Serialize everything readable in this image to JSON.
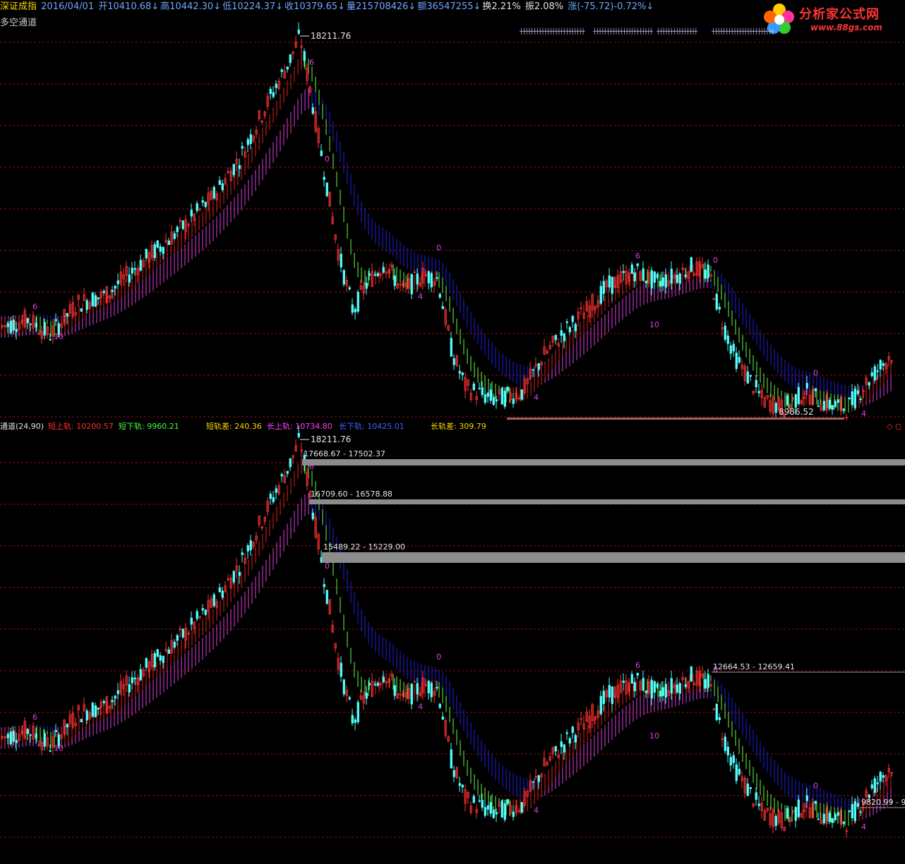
{
  "header": {
    "name": "深证成指",
    "date": "2016/04/01",
    "open": "开10410.68↓",
    "high": "高10442.30↓",
    "low": "低10224.37↓",
    "close": "收10379.65↓",
    "volume": "量215708426↓",
    "amount": "额36547255↓",
    "turnover": "换2.21%",
    "amplitude": "振2.08%",
    "change": "涨(-75.72)-0.72%↓"
  },
  "indicator_name": "多空通道",
  "logo": {
    "text": "分析家公式网",
    "url": "www.88gs.com"
  },
  "sub_header": {
    "name": "通道(24,90)",
    "short_upper": "短上轨: 10200.57",
    "short_lower": "短下轨: 9960.21",
    "short_diff": "短轨差: 240.36",
    "long_upper": "长上轨: 10734.80",
    "long_lower": "长下轨: 10425.01",
    "long_diff": "长轨差: 309.79"
  },
  "controls": {
    "diamond": "◇",
    "square": "◻"
  },
  "annotations": {
    "peak": "18211.76",
    "trough": "8986.52",
    "zone1": "17668.67 - 17502.37",
    "zone2": "16709.60 - 16578.88",
    "zone3": "15489.22 - 15229.00",
    "zone4": "12664.53 - 12659.41",
    "zone5": "9820.99 - 9",
    "counts": [
      "6",
      "10",
      "6",
      "0",
      "0",
      "4",
      "4",
      "6",
      "10",
      "0",
      "0",
      "4",
      "4"
    ]
  },
  "colors": {
    "up": "#ff3232",
    "down": "#54ffff",
    "short_band_up": "#e02020",
    "short_band_down": "#66ff44",
    "long_band_up": "#e040e0",
    "long_band_down": "#2020e0",
    "grid": "#8a1010",
    "count": "#e040e0",
    "header_yellow": "#ffd700",
    "header_blue": "#6fa6ff"
  }
}
